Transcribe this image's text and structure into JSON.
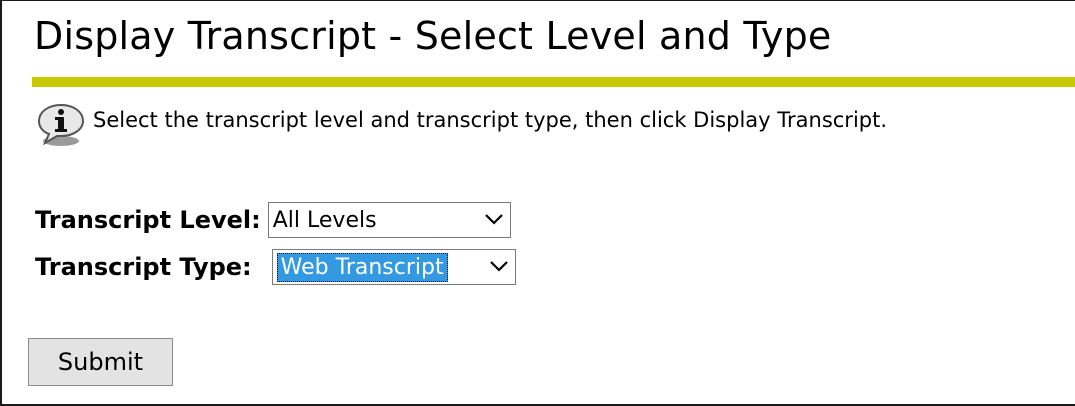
{
  "page": {
    "title": "Display Transcript - Select Level and Type",
    "accent_color": "#c8c800"
  },
  "info": {
    "icon": "info-speech-bubble-icon",
    "text": "Select the transcript level and transcript type, then click Display Transcript."
  },
  "form": {
    "level": {
      "label": "Transcript Level:",
      "selected": "All Levels"
    },
    "type": {
      "label": "Transcript Type:",
      "selected": "Web Transcript",
      "highlight_color": "#3399e0"
    },
    "submit_label": "Submit"
  }
}
